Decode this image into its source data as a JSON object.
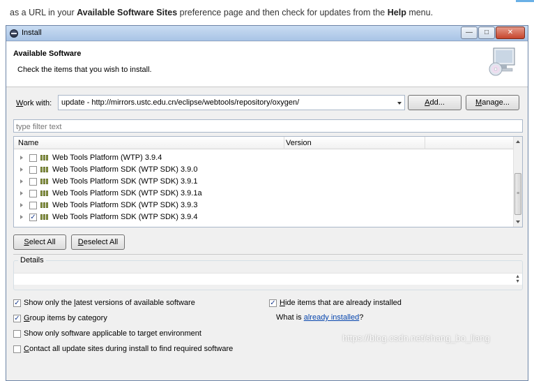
{
  "intro": {
    "part1": "as a URL in your ",
    "bold1": "Available Software Sites",
    "part2": " preference page and then check for updates from the ",
    "bold2": "Help",
    "part3": " menu."
  },
  "window": {
    "title": "Install",
    "header_title": "Available Software",
    "header_desc": "Check the items that you wish to install."
  },
  "work_with": {
    "label_pre": "",
    "label_u": "W",
    "label_post": "ork with:",
    "value": "update - http://mirrors.ustc.edu.cn/eclipse/webtools/repository/oxygen/",
    "add_u": "A",
    "add_post": "dd...",
    "manage_u": "M",
    "manage_post": "anage..."
  },
  "filter": {
    "placeholder": "type filter text"
  },
  "table": {
    "columns": [
      "Name",
      "Version"
    ],
    "rows": [
      {
        "label": "Web Tools Platform (WTP) 3.9.4",
        "checked": false
      },
      {
        "label": "Web Tools Platform SDK (WTP SDK) 3.9.0",
        "checked": false
      },
      {
        "label": "Web Tools Platform SDK (WTP SDK) 3.9.1",
        "checked": false
      },
      {
        "label": "Web Tools Platform SDK (WTP SDK) 3.9.1a",
        "checked": false
      },
      {
        "label": "Web Tools Platform SDK (WTP SDK) 3.9.3",
        "checked": false
      },
      {
        "label": "Web Tools Platform SDK (WTP SDK) 3.9.4",
        "checked": true
      }
    ]
  },
  "buttons": {
    "select_all_u": "S",
    "select_all_post": "elect All",
    "deselect_all_u": "D",
    "deselect_all_post": "eselect All"
  },
  "details": {
    "label": "Details"
  },
  "options": {
    "latest_pre": "Show only the ",
    "latest_u": "l",
    "latest_post": "atest versions of available software",
    "latest_checked": true,
    "group_u": "G",
    "group_post": "roup items by category",
    "group_checked": true,
    "target_label": "Show only software applicable to target environment",
    "target_checked": false,
    "contact_u": "C",
    "contact_post": "ontact all update sites during install to find required software",
    "contact_checked": false,
    "hide_u": "H",
    "hide_post": "ide items that are already installed",
    "hide_checked": true,
    "whatis_pre": "What is ",
    "whatis_link": "already installed",
    "whatis_post": "?"
  },
  "watermark": "https://blog.csdn.net/shang_bo_liang",
  "icons": {
    "title": "eclipse-icon",
    "banner": "install-monitor-cd-icon",
    "checkmark": "✓"
  },
  "colors": {
    "titlebar": "#b9d1ee",
    "close_button": "#c6452d",
    "link": "#0645ad"
  }
}
